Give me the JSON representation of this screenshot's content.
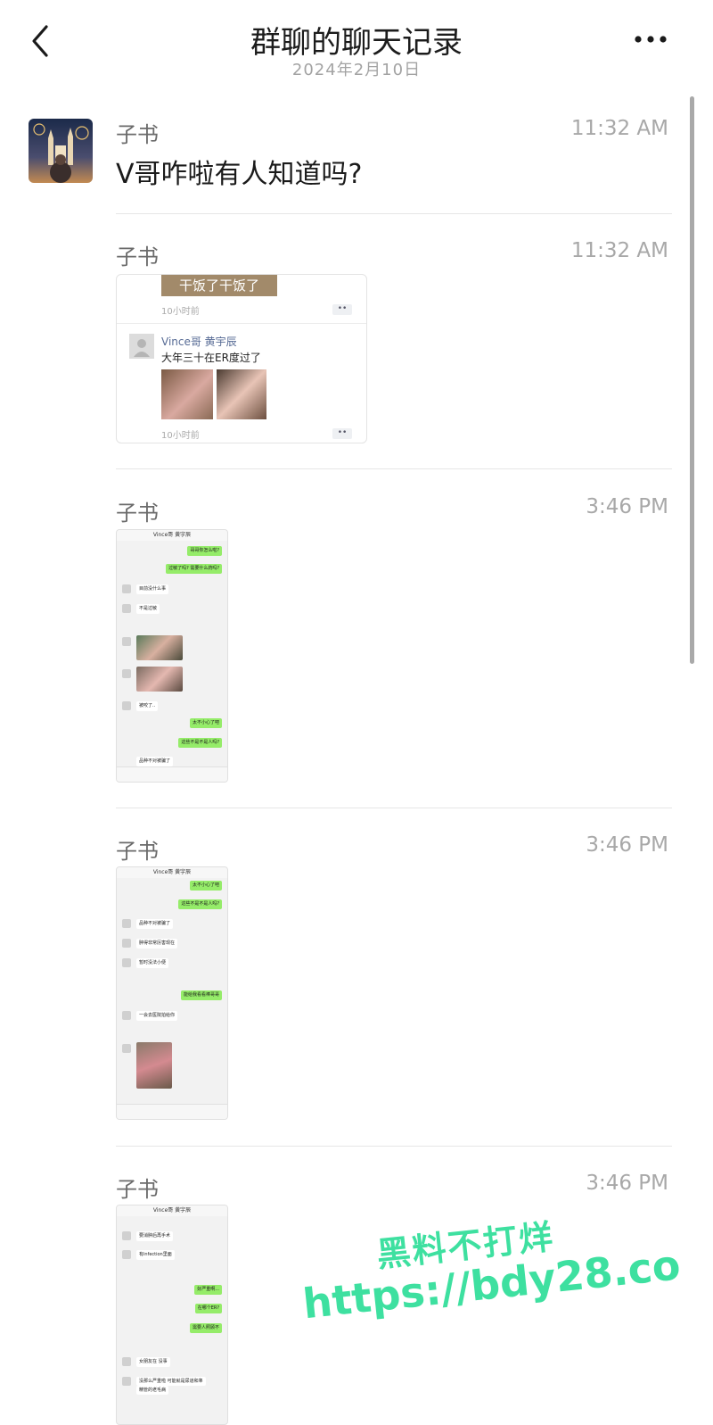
{
  "header": {
    "title": "群聊的聊天记录",
    "date": "2024年2月10日"
  },
  "messages": [
    {
      "sender": "子书",
      "time": "11:32 AM",
      "text": "V哥咋啦有人知道吗?"
    },
    {
      "sender": "子书",
      "time": "11:32 AM",
      "type": "moments-card"
    },
    {
      "sender": "子书",
      "time": "3:46 PM",
      "type": "chat-screenshot"
    },
    {
      "sender": "子书",
      "time": "3:46 PM",
      "type": "chat-screenshot"
    },
    {
      "sender": "子书",
      "time": "3:46 PM",
      "type": "chat-screenshot"
    }
  ],
  "moments_card": {
    "banner": "干饭了干饭了",
    "ago_top": "10小时前",
    "name": "Vince哥 黄宇辰",
    "text": "大年三十在ER度过了",
    "ago_bottom": "10小时前",
    "more": "••"
  },
  "shot1": {
    "title": "Vince哥 黄宇辰",
    "g1": "哥哥你怎么啦?",
    "g2": "过敏了吗? 需要什么药吗?",
    "w1": "目前没什么事",
    "w2": "不是过敏",
    "w3": "被咬了..",
    "g3": "太不小心了吧",
    "g4": "这些不是不是人吗?",
    "w4": "品种不对被骗了"
  },
  "shot2": {
    "title": "Vince哥 黄宇辰",
    "g1": "太不小心了吧",
    "g2": "这些不是不是人吗?",
    "w1": "品种不对被骗了",
    "w2": "肿得非常厉害现在",
    "w3": "暂时没法小便",
    "g3": "能给我看看棒哥哥",
    "w4": "一会去医院拍给你"
  },
  "shot3": {
    "title": "Vince哥 黄宇辰",
    "w1": "要消肿后再手术",
    "w2": "有infection里面",
    "g1": "好严重啊...",
    "g2": "在哪个ER?",
    "g3": "需要人照顾不",
    "w3": "女朋友在 没事",
    "w4": "没那么严重啦 可能就是尿道和睾",
    "w5": "精管的老毛病"
  },
  "watermark": {
    "line1": "黑料不打烊",
    "line2": "https://bdy28.co"
  },
  "colors": {
    "accent_green": "#95ec69",
    "watermark": "#3ee0a0",
    "link_blue": "#576b95"
  }
}
